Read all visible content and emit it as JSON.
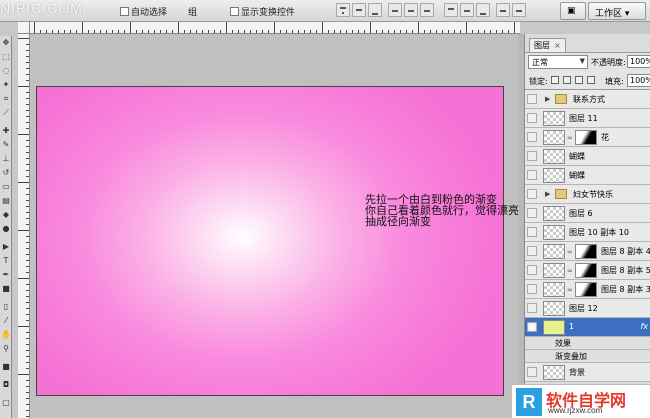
{
  "options_bar": {
    "watermark": "NIPIC.COM",
    "auto_select_label": "自动选择",
    "group_label": "组",
    "show_transform_label": "显示变换控件",
    "workspace_label": "工作区 ▾"
  },
  "canvas": {
    "annotation_lines": [
      "先拉一个由白到粉色的渐变",
      "你自己看着颜色就行，觉得漂亮就行",
      "抽成径向渐变"
    ]
  },
  "layers_panel": {
    "tab_label": "图层",
    "blend_mode": "正常",
    "opacity_label": "不透明度:",
    "opacity_value": "100%",
    "lock_label": "锁定:",
    "fill_label": "填充:",
    "fill_value": "100%",
    "layers": [
      {
        "name": "联系方式",
        "kind": "group"
      },
      {
        "name": "图层 11",
        "kind": "layer"
      },
      {
        "name": "花",
        "kind": "masked"
      },
      {
        "name": "蝴蝶",
        "kind": "layer"
      },
      {
        "name": "蝴蝶",
        "kind": "layer"
      },
      {
        "name": "妇女节快乐",
        "kind": "group"
      },
      {
        "name": "图层 6",
        "kind": "layer"
      },
      {
        "name": "图层 10 副本 10",
        "kind": "layer"
      },
      {
        "name": "图层 8 副本 4",
        "kind": "masked"
      },
      {
        "name": "图层 8 副本 5",
        "kind": "masked"
      },
      {
        "name": "图层 8 副本 3",
        "kind": "masked"
      },
      {
        "name": "图层 12",
        "kind": "layer"
      },
      {
        "name": "1",
        "kind": "selected"
      },
      {
        "name": "效果",
        "kind": "sub"
      },
      {
        "name": "渐变叠加",
        "kind": "sub"
      },
      {
        "name": "背景",
        "kind": "layer"
      }
    ]
  },
  "site_logo": {
    "mark": "R",
    "title": "软件自学网",
    "url": "www.rjzxw.com"
  },
  "colors": {
    "canvas_pink": "#f671d6",
    "selection_blue": "#3c6fc0"
  }
}
